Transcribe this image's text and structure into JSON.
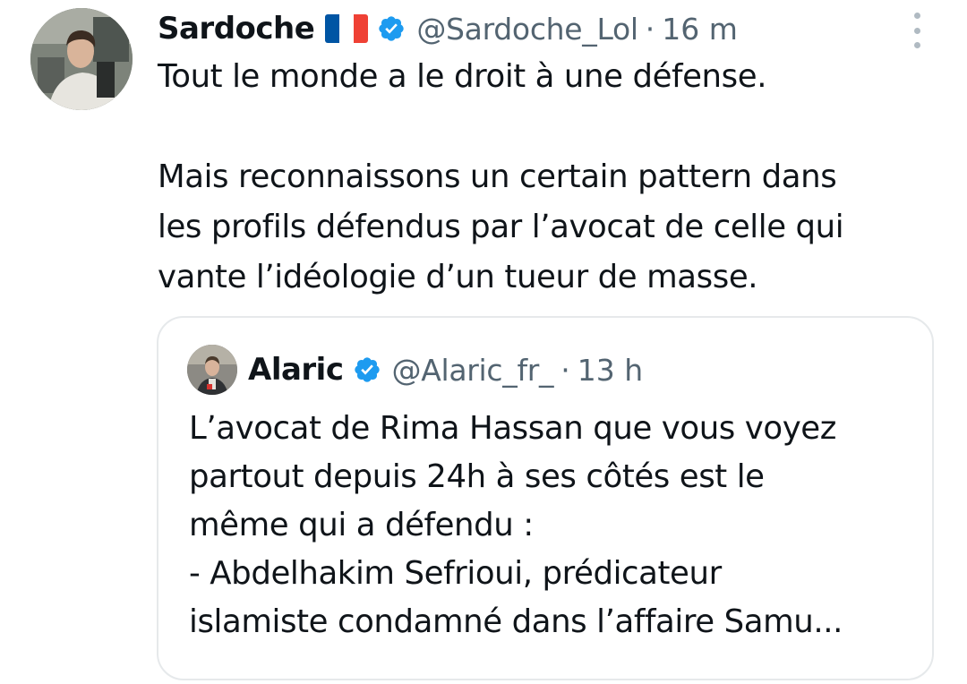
{
  "tweet": {
    "author": {
      "display_name": "Sardoche",
      "flag_icon": "france-flag-icon",
      "flag_colors": [
        "#0055A4",
        "#FFFFFF",
        "#EF4135"
      ],
      "verified_icon": "verified-badge-icon",
      "verified_color": "#1d9bf0",
      "handle": "@Sardoche_Lol",
      "separator": "·",
      "timestamp": "16 m"
    },
    "more_icon": "more-vertical-icon",
    "text_lines": [
      "Tout le monde a le droit à une défense.",
      "Mais reconnaissons un certain pattern dans",
      "les profils défendus par l’avocat de celle qui",
      "vante l’idéologie d’un tueur de masse."
    ]
  },
  "quote": {
    "author": {
      "display_name": "Alaric",
      "verified_icon": "verified-badge-icon",
      "handle": "@Alaric_fr_",
      "separator": "·",
      "timestamp": "13 h"
    },
    "text_lines": [
      "L’avocat de Rima Hassan que vous voyez",
      "partout depuis 24h à ses côtés est le",
      "même qui a défendu :",
      "- Abdelhakim Sefrioui, prédicateur",
      "islamiste condamné dans l’affaire Samu..."
    ]
  },
  "colors": {
    "text_primary": "#0f1419",
    "text_secondary": "#536471",
    "card_border": "#e6e9eb",
    "accent": "#1d9bf0"
  }
}
